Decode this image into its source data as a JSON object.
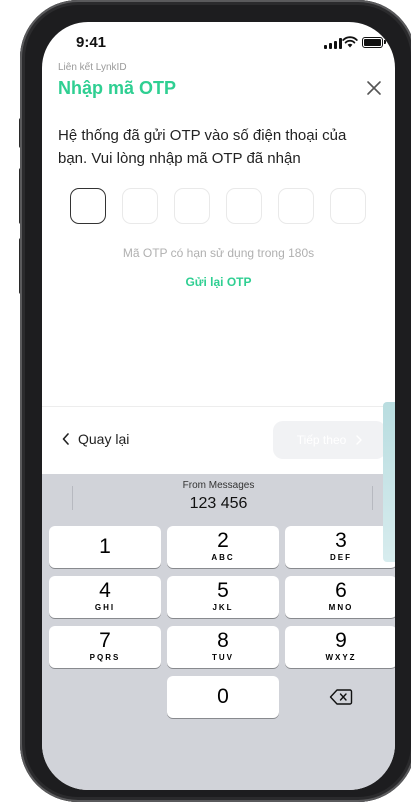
{
  "status_bar": {
    "time": "9:41"
  },
  "header": {
    "subtitle": "Liên kết LynkID",
    "title": "Nhập mã OTP"
  },
  "description": "Hệ thống đã gửi OTP vào số điện thoại của bạn. Vui lòng nhập mã OTP đã nhận",
  "otp": {
    "length": 6,
    "values": [
      "",
      "",
      "",
      "",
      "",
      ""
    ]
  },
  "hint": "Mã OTP có hạn sử dụng trong 180s",
  "resend_label": "Gửi lại OTP",
  "actions": {
    "back_label": "Quay lại",
    "next_label": "Tiếp theo"
  },
  "keyboard": {
    "suggestion_source": "From Messages",
    "suggestion_code": "123 456",
    "keys": [
      {
        "digit": "1",
        "letters": ""
      },
      {
        "digit": "2",
        "letters": "ABC"
      },
      {
        "digit": "3",
        "letters": "DEF"
      },
      {
        "digit": "4",
        "letters": "GHI"
      },
      {
        "digit": "5",
        "letters": "JKL"
      },
      {
        "digit": "6",
        "letters": "MNO"
      },
      {
        "digit": "7",
        "letters": "PQRS"
      },
      {
        "digit": "8",
        "letters": "TUV"
      },
      {
        "digit": "9",
        "letters": "WXYZ"
      },
      {
        "digit": "0",
        "letters": ""
      }
    ]
  },
  "colors": {
    "accent": "#2fcf92",
    "keyboard_bg": "#d1d3d9",
    "disabled_button": "#f1f2f4"
  }
}
